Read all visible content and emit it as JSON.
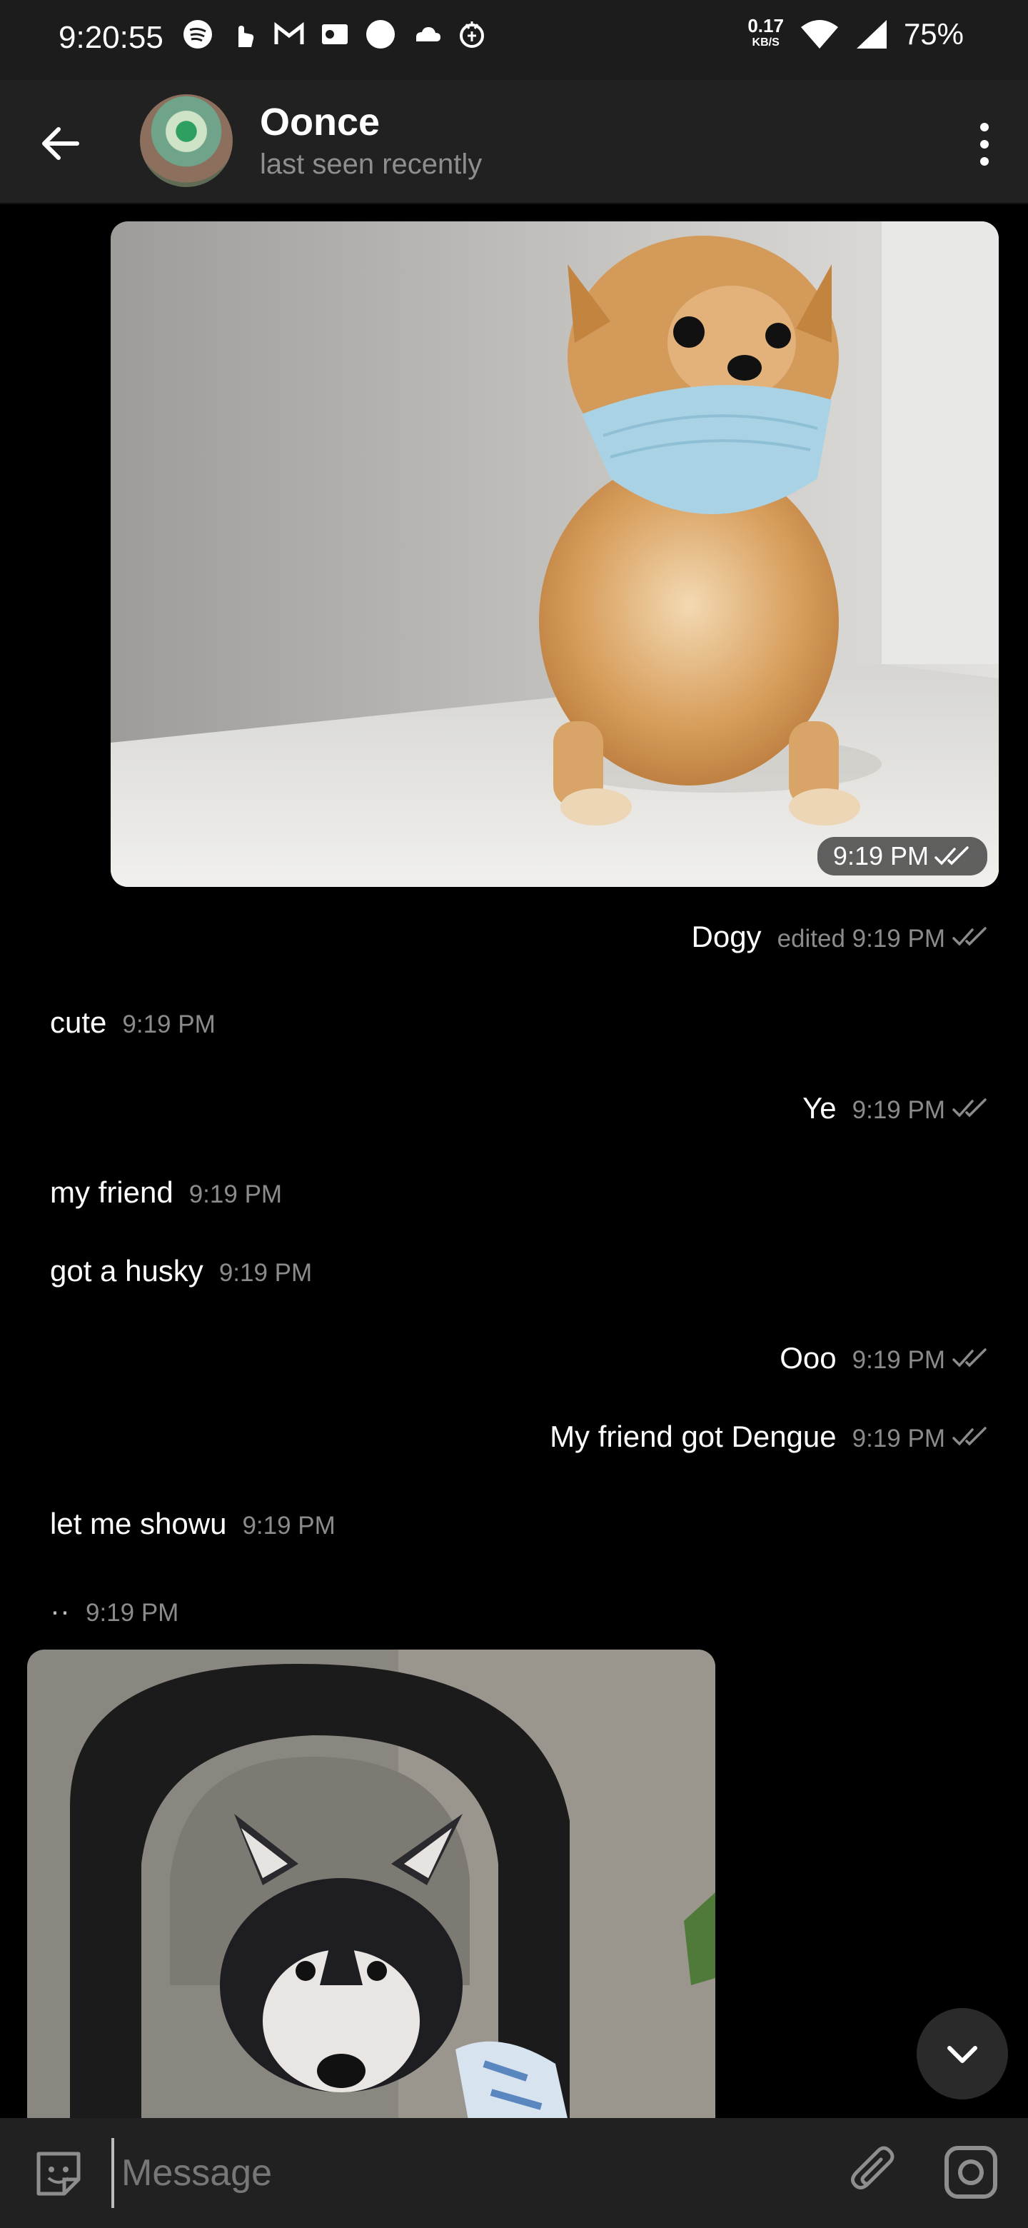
{
  "status_bar": {
    "time": "9:20:55",
    "speed_value": "0.17",
    "speed_unit": "KB/S",
    "battery": "75%"
  },
  "header": {
    "name": "Oonce",
    "status": "last seen recently"
  },
  "messages": [
    {
      "kind": "photo",
      "side": "out",
      "time": "9:19 PM"
    },
    {
      "kind": "text",
      "side": "out",
      "text": "Dogy",
      "time": "edited 9:19 PM"
    },
    {
      "kind": "text",
      "side": "in",
      "text": "cute",
      "time": "9:19 PM"
    },
    {
      "kind": "text",
      "side": "out",
      "text": "Ye",
      "time": "9:19 PM"
    },
    {
      "kind": "text",
      "side": "in",
      "text": "my friend",
      "time": "9:19 PM"
    },
    {
      "kind": "text",
      "side": "in",
      "text": "got a husky",
      "time": "9:19 PM"
    },
    {
      "kind": "text",
      "side": "out",
      "text": "Ooo",
      "time": "9:19 PM"
    },
    {
      "kind": "text",
      "side": "out",
      "text": "My friend got Dengue",
      "time": "9:19 PM"
    },
    {
      "kind": "text",
      "side": "in",
      "text": "let me showu",
      "time": "9:19 PM"
    },
    {
      "kind": "text",
      "side": "in",
      "text": "··",
      "time": "9:19 PM"
    },
    {
      "kind": "photo",
      "side": "in"
    }
  ],
  "composer": {
    "placeholder": "Message"
  },
  "colors": {
    "background": "#000000",
    "bar": "#212121",
    "time_gray": "#8b8b8b"
  },
  "icons": [
    "back-arrow-icon",
    "more-vert-icon",
    "double-check-icon",
    "emoji-icon",
    "attach-icon",
    "camera-icon",
    "chevron-down-icon"
  ]
}
